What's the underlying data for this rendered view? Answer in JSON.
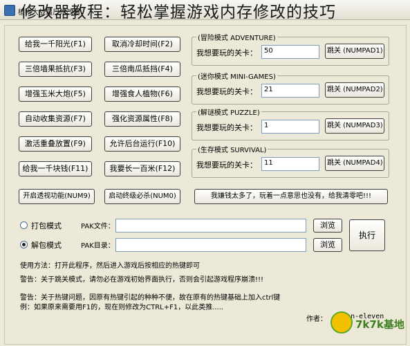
{
  "overlay_title": "修改器教程：轻松掌握游戏内存修改的技巧",
  "window_title": "植物大战僵尸修改器",
  "buttons_left": [
    {
      "left": "给我一千阳光(F1)",
      "right": "取消冷却时间(F2)"
    },
    {
      "left": "三倍墙果抵抗(F3)",
      "right": "三倍南瓜抵挡(F4)"
    },
    {
      "left": "增强玉米大炮(F5)",
      "right": "增强食人植物(F6)"
    },
    {
      "left": "自动收集资源(F7)",
      "right": "强化资源属性(F8)"
    },
    {
      "left": "激活重叠放置(F9)",
      "right": "允许后台运行(F10)"
    },
    {
      "left": "给我一千块钱(F11)",
      "right": "我要长一百米(F12)"
    },
    {
      "left": "开启透视功能(NUM9)",
      "right": "启动终级必杀(NUM0)"
    }
  ],
  "level_groups": [
    {
      "title": "(冒险模式 ADVENTURE)",
      "label": "我想要玩的关卡：",
      "value": "50",
      "button": "跳关 (NUMPAD1)"
    },
    {
      "title": "(迷你模式 MINI-GAMES)",
      "label": "我想要玩的关卡：",
      "value": "21",
      "button": "跳关 (NUMPAD2)"
    },
    {
      "title": "(解谜模式 PUZZLE)",
      "label": "我想要玩的关卡：",
      "value": "1",
      "button": "跳关 (NUMPAD3)"
    },
    {
      "title": "(生存模式 SURVIVAL)",
      "label": "我想要玩的关卡：",
      "value": "11",
      "button": "跳关 (NUMPAD4)"
    }
  ],
  "money_button": "我嫌钱太多了，玩着一点意思也没有，给我清零吧!!!",
  "pack": {
    "option1": "打包模式",
    "option2": "解包模式",
    "file_label": "PAK文件：",
    "dir_label": "PAK目录：",
    "browse": "浏览",
    "execute": "执行"
  },
  "notes": [
    "使用方法：打开此程序，然后进入游戏后按相应的热键即可",
    "警告：关于跳关模式，请勿必在游戏初始界面执行，否则会引起游戏程序崩溃!!!",
    "警告：关于热键问题，因原有热键引起的种种不便，故在原有的热键基础上加入ctrl键",
    "例：如果原来需要用F1的，现在则修改为CTRL+F1，以此类推....."
  ],
  "author_label": "作者：",
  "author": "seven-eleven",
  "logo_text": "7k7k基地"
}
